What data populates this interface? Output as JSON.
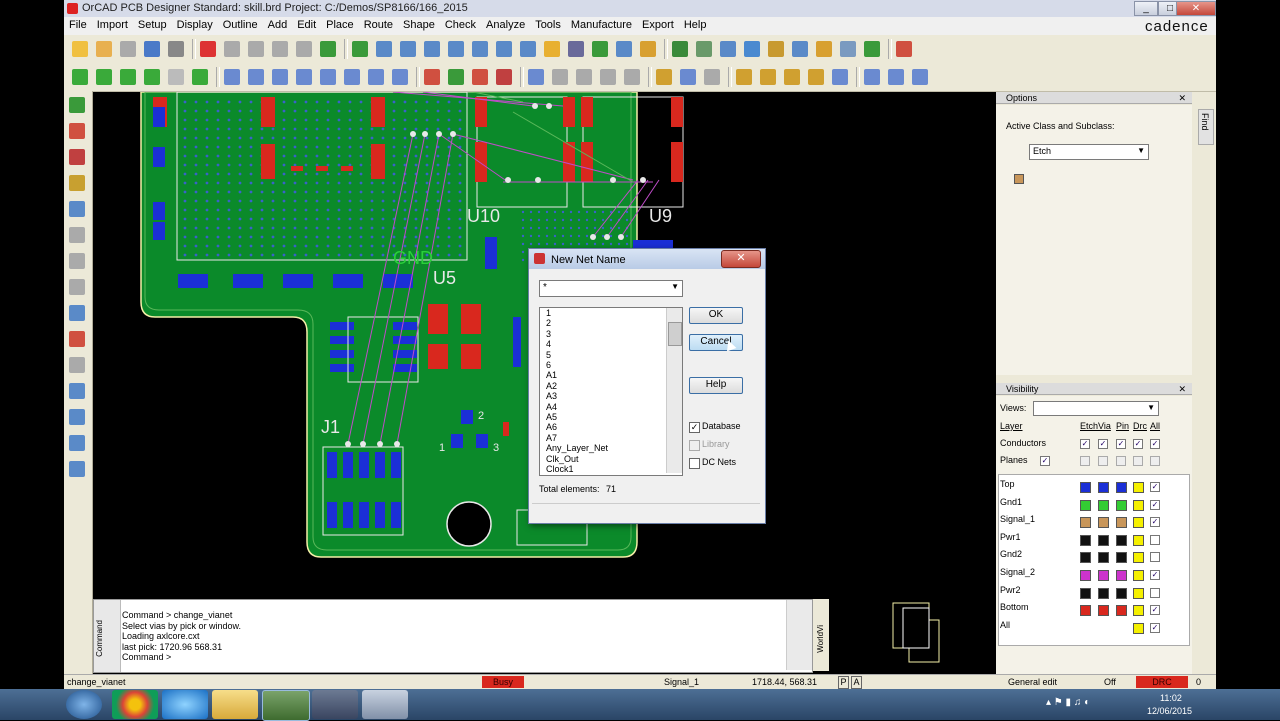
{
  "window": {
    "title": "OrCAD PCB Designer Standard: skill.brd  Project: C:/Demos/SP8166/166_2015",
    "brand": "cadence",
    "min": "_",
    "max": "□",
    "close": "✕"
  },
  "menu": [
    "File",
    "Import",
    "Setup",
    "Display",
    "Outline",
    "Add",
    "Edit",
    "Place",
    "Route",
    "Shape",
    "Check",
    "Analyze",
    "Tools",
    "Manufacture",
    "Export",
    "Help"
  ],
  "board": {
    "labels": {
      "u10": "U10",
      "u9": "U9",
      "u5": "U5",
      "gnd": "GND",
      "j1": "J1",
      "pin1": "1",
      "pin2": "2",
      "pin3": "3"
    },
    "colors": {
      "board": "#0b8a2a",
      "outline": "#f5f0a8",
      "pad_red": "#d9281e",
      "pad_blue": "#1b2fd6",
      "ratsnest": "#c04cc9",
      "silk": "#e8e8e8"
    }
  },
  "dialog": {
    "title": "New Net Name",
    "combo_value": "*",
    "nets": [
      "1",
      "2",
      "3",
      "4",
      "5",
      "6",
      "A1",
      "A2",
      "A3",
      "A4",
      "A5",
      "A6",
      "A7",
      "Any_Layer_Net",
      "Clk_Out",
      "Clock1"
    ],
    "ok": "OK",
    "cancel": "Cancel",
    "help": "Help",
    "database": "Database",
    "library": "Library",
    "dc_nets": "DC Nets",
    "total_label": "Total elements:",
    "total_value": "71",
    "close": "✕"
  },
  "options": {
    "header": "Options",
    "class_label": "Active Class and Subclass:",
    "class_value": "Etch",
    "find_tab": "Find"
  },
  "visibility": {
    "header": "Visibility",
    "views_label": "Views:",
    "cols": [
      "Layer",
      "Etch",
      "Via",
      "Pin",
      "Drc",
      "All"
    ],
    "conductors": "Conductors",
    "planes": "Planes",
    "layers": [
      {
        "name": "Top",
        "color": "#1b2fd6"
      },
      {
        "name": "Gnd1",
        "color": "#33cc33"
      },
      {
        "name": "Signal_1",
        "color": "#c8965a"
      },
      {
        "name": "Pwr1",
        "color": "#111111"
      },
      {
        "name": "Gnd2",
        "color": "#111111"
      },
      {
        "name": "Signal_2",
        "color": "#cc33cc"
      },
      {
        "name": "Pwr2",
        "color": "#111111"
      },
      {
        "name": "Bottom",
        "color": "#d9281e"
      },
      {
        "name": "All",
        "color": ""
      }
    ]
  },
  "command": {
    "tab": "Command",
    "lines": [
      "Command > change_vianet",
      "Select vias by pick or window.",
      "Loading axlcore.cxt",
      "last pick:  1720.96 568.31",
      "Command >"
    ],
    "worldview_tab": "WorldVi"
  },
  "status": {
    "command": "change_vianet",
    "busy": "Busy",
    "layer": "Signal_1",
    "coords": "1718.44, 568.31",
    "p": "P",
    "a": "A",
    "mode": "General edit",
    "off": "Off",
    "drc": "DRC",
    "count": "0"
  },
  "taskbar": {
    "time": "11:02",
    "date": "12/06/2015"
  }
}
